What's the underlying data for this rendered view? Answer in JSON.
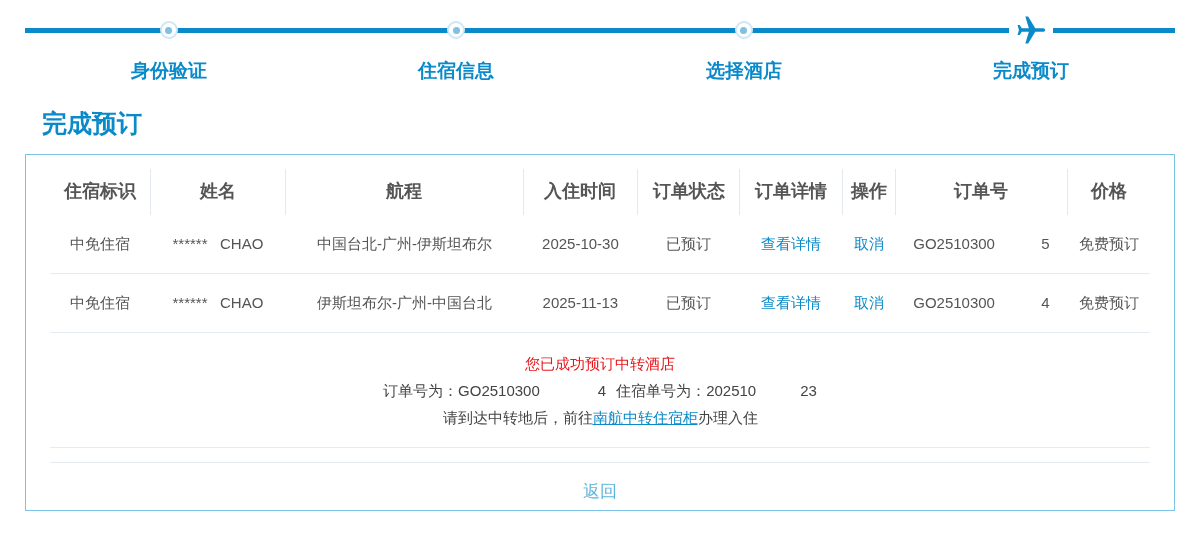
{
  "steps": [
    {
      "label": "身份验证",
      "current": false
    },
    {
      "label": "住宿信息",
      "current": false
    },
    {
      "label": "选择酒店",
      "current": false
    },
    {
      "label": "完成预订",
      "current": true
    }
  ],
  "page_title": "完成预订",
  "table": {
    "columns": [
      "住宿标识",
      "姓名",
      "航程",
      "入住时间",
      "订单状态",
      "订单详情",
      "操作",
      "订单号",
      "价格"
    ],
    "rows": [
      {
        "type": "中免住宿",
        "name": "******   CHAO",
        "route": "中国台北-广州-伊斯坦布尔",
        "checkin": "2025-10-30",
        "status": "已预订",
        "details_link": "查看详情",
        "action_link": "取消",
        "order_no": "GO2510300",
        "order_suffix": "5",
        "price": "免费预订"
      },
      {
        "type": "中免住宿",
        "name": "******   CHAO",
        "route": "伊斯坦布尔-广州-中国台北",
        "checkin": "2025-11-13",
        "status": "已预订",
        "details_link": "查看详情",
        "action_link": "取消",
        "order_no": "GO2510300",
        "order_suffix": "4",
        "price": "免费预订"
      }
    ]
  },
  "summary": {
    "success": "您已成功预订中转酒店",
    "order_label": "订单号为：GO2510300",
    "order_suffix": "4",
    "stay_label": "住宿单号为：202510",
    "stay_suffix": "23",
    "instruction_before": "请到达中转地后，前往",
    "instruction_link": "南航中转住宿柜",
    "instruction_after": "办理入住"
  },
  "back_link": "返回"
}
